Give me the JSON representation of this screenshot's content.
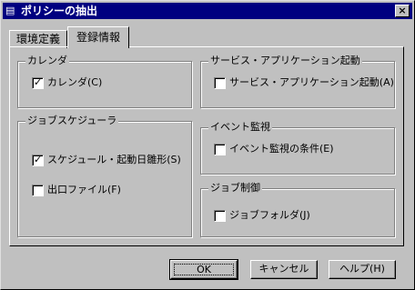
{
  "window": {
    "title": "ポリシーの抽出",
    "icon": "app-icon",
    "close_label": "×"
  },
  "tabs": [
    {
      "label": "環境定義",
      "active": false
    },
    {
      "label": "登録情報",
      "active": true
    }
  ],
  "groups": {
    "calendar": {
      "title": "カレンダ",
      "checkbox": {
        "label": "カレンダ(C)",
        "checked": true
      }
    },
    "service": {
      "title": "サービス・アプリケーション起動",
      "checkbox": {
        "label": "サービス・アプリケーション起動(A)",
        "checked": false
      }
    },
    "scheduler": {
      "title": "ジョブスケジューラ",
      "checkboxes": [
        {
          "label": "スケジュール・起動日雛形(S)",
          "checked": true
        },
        {
          "label": "出口ファイル(F)",
          "checked": false
        }
      ]
    },
    "event": {
      "title": "イベント監視",
      "checkbox": {
        "label": "イベント監視の条件(E)",
        "checked": false
      }
    },
    "job": {
      "title": "ジョブ制御",
      "checkbox": {
        "label": "ジョブフォルダ(J)",
        "checked": false
      }
    }
  },
  "buttons": {
    "ok": "OK",
    "cancel": "キャンセル",
    "help": "ヘルプ(H)"
  },
  "check_mark": "✓"
}
